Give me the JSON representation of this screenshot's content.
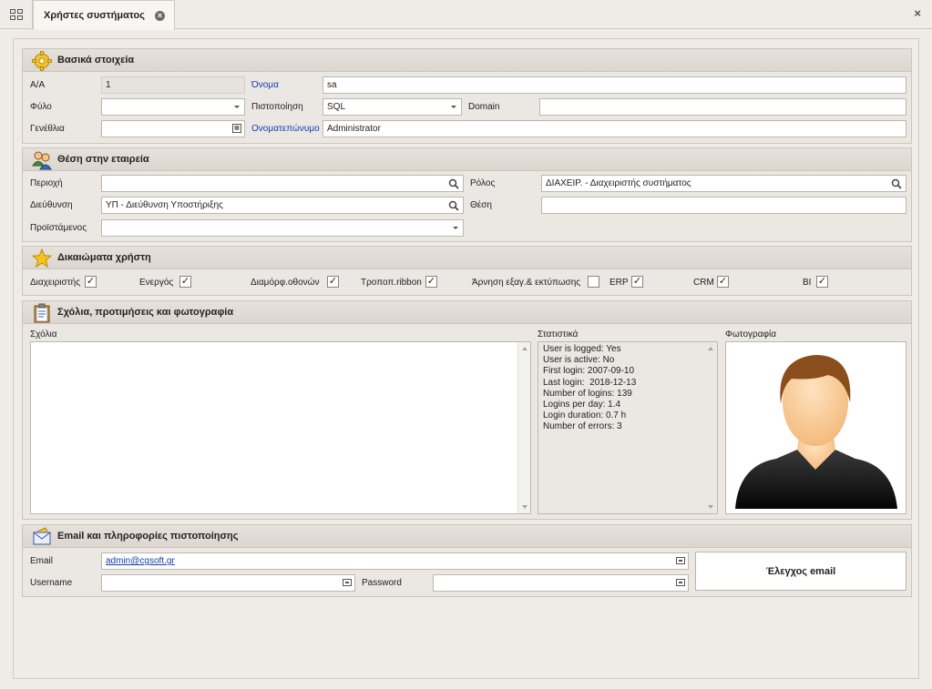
{
  "tab": {
    "title": "Χρήστες συστήματος"
  },
  "sections": {
    "basic": {
      "title": "Βασικά στοιχεία",
      "aa_label": "Α/Α",
      "aa_value": "1",
      "name_label": "Όνομα",
      "name_value": "sa",
      "gender_label": "Φύλο",
      "gender_value": "",
      "auth_label": "Πιστοποίηση",
      "auth_value": "SQL",
      "domain_label": "Domain",
      "domain_value": "",
      "birth_label": "Γενέθλια",
      "birth_value": "",
      "fullname_label": "Ονοματεπώνυμο",
      "fullname_value": "Administrator"
    },
    "position": {
      "title": "Θέση στην εταιρεία",
      "region_label": "Περιοχή",
      "region_value": "",
      "role_label": "Ρόλος",
      "role_value": "ΔΙΑΧΕΙΡ. - Διαχειριστής συστήματος",
      "direction_label": "Διεύθυνση",
      "direction_value": "ΥΠ - Διεύθυνση Υποστήριξης",
      "post_label": "Θέση",
      "post_value": "",
      "manager_label": "Προϊστάμενος",
      "manager_value": ""
    },
    "rights": {
      "title": "Δικαιώματα χρήστη",
      "items": [
        {
          "label": "Διαχειριστής",
          "checked": true
        },
        {
          "label": "Ενεργός",
          "checked": true
        },
        {
          "label": "Διαμόρφ.οθονών",
          "checked": true
        },
        {
          "label": "Τροποπ.ribbon",
          "checked": true
        },
        {
          "label": "Άρνηση εξαγ.& εκτύπωσης",
          "checked": false
        },
        {
          "label": "ERP",
          "checked": true
        },
        {
          "label": "CRM",
          "checked": true
        },
        {
          "label": "BI",
          "checked": true
        }
      ]
    },
    "comments": {
      "title": "Σχόλια, προτιμήσεις και φωτογραφία",
      "comments_label": "Σχόλια",
      "stats_label": "Στατιστικά",
      "photo_label": "Φωτογραφία",
      "stats": [
        "User is logged: Yes",
        "User is active: No",
        "First login: 2007-09-10",
        "Last login:  2018-12-13",
        "Number of logins: 139",
        "Logins per day: 1.4",
        "Login duration: 0.7 h",
        "Number of errors: 3"
      ]
    },
    "email": {
      "title": "Email και πληροφορίες πιστοποίησης",
      "email_label": "Email",
      "email_value": "admin@cgsoft.gr",
      "username_label": "Username",
      "username_value": "",
      "password_label": "Password",
      "password_value": "",
      "check_button": "Έλεγχος email"
    }
  },
  "colors": {
    "accent_blue": "#1a3bb0",
    "panel": "#ebe7e2"
  }
}
